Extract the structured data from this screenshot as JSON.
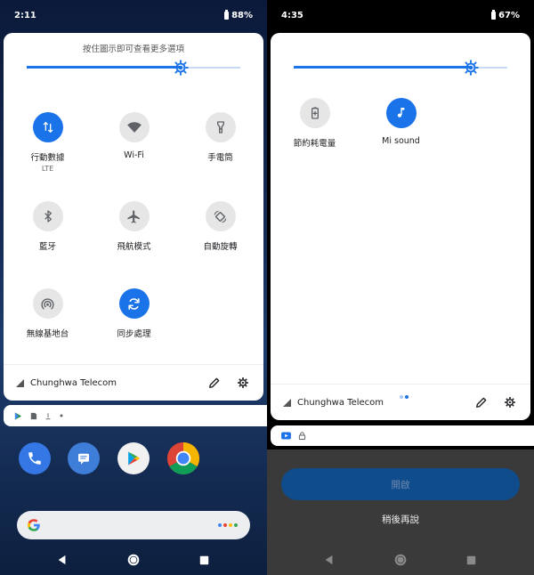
{
  "left": {
    "status": {
      "time": "2:11",
      "battery": "88%"
    },
    "hint": "按住圖示即可查看更多選項",
    "brightness": 0.72,
    "tiles": [
      {
        "label": "行動數據",
        "sub": "LTE",
        "icon": "mobile-data-icon",
        "active": true
      },
      {
        "label": "Wi-Fi",
        "icon": "wifi-icon",
        "active": false
      },
      {
        "label": "手電筒",
        "icon": "flashlight-icon",
        "active": false
      },
      {
        "label": "藍牙",
        "icon": "bluetooth-icon",
        "active": false
      },
      {
        "label": "飛航模式",
        "icon": "airplane-icon",
        "active": false
      },
      {
        "label": "自動旋轉",
        "icon": "auto-rotate-icon",
        "active": false
      },
      {
        "label": "無線基地台",
        "icon": "hotspot-icon",
        "active": false
      },
      {
        "label": "同步處理",
        "icon": "sync-icon",
        "active": true
      }
    ],
    "carrier": "Chunghwa Telecom"
  },
  "right": {
    "status": {
      "time": "4:35",
      "battery": "67%"
    },
    "brightness": 0.83,
    "tiles": [
      {
        "label": "節約耗電量",
        "icon": "battery-saver-icon",
        "active": false
      },
      {
        "label": "Mi sound",
        "icon": "music-note-icon",
        "active": true
      }
    ],
    "carrier": "Chunghwa Telecom",
    "open_button": "開啟",
    "later": "稍後再說"
  }
}
